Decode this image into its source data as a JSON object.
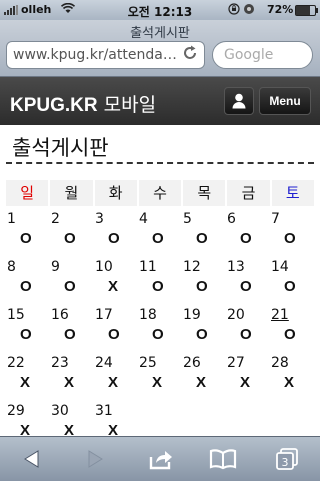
{
  "status_bar": {
    "carrier": "olleh",
    "time": "오전 12:13",
    "battery_percent": "72%",
    "battery_level": 0.72
  },
  "browser": {
    "page_title": "출석게시판",
    "url": "www.kpug.kr/attendan…",
    "search_placeholder": "Google",
    "tab_count": "3"
  },
  "site": {
    "logo_brand": "KPUG.KR",
    "logo_suffix": "모바일",
    "menu_label": "Menu"
  },
  "page": {
    "heading": "출석게시판"
  },
  "weekdays": [
    {
      "label": "일",
      "color": "#e00000"
    },
    {
      "label": "월",
      "color": "#111111"
    },
    {
      "label": "화",
      "color": "#111111"
    },
    {
      "label": "수",
      "color": "#111111"
    },
    {
      "label": "목",
      "color": "#111111"
    },
    {
      "label": "금",
      "color": "#111111"
    },
    {
      "label": "토",
      "color": "#2020d0"
    }
  ],
  "calendar": {
    "weeks": [
      [
        {
          "day": "1",
          "mark": "O"
        },
        {
          "day": "2",
          "mark": "O"
        },
        {
          "day": "3",
          "mark": "O"
        },
        {
          "day": "4",
          "mark": "O"
        },
        {
          "day": "5",
          "mark": "O"
        },
        {
          "day": "6",
          "mark": "O"
        },
        {
          "day": "7",
          "mark": "O"
        }
      ],
      [
        {
          "day": "8",
          "mark": "O"
        },
        {
          "day": "9",
          "mark": "O"
        },
        {
          "day": "10",
          "mark": "X"
        },
        {
          "day": "11",
          "mark": "O"
        },
        {
          "day": "12",
          "mark": "O"
        },
        {
          "day": "13",
          "mark": "O"
        },
        {
          "day": "14",
          "mark": "O"
        }
      ],
      [
        {
          "day": "15",
          "mark": "O"
        },
        {
          "day": "16",
          "mark": "O"
        },
        {
          "day": "17",
          "mark": "O"
        },
        {
          "day": "18",
          "mark": "O"
        },
        {
          "day": "19",
          "mark": "O"
        },
        {
          "day": "20",
          "mark": "O"
        },
        {
          "day": "21",
          "mark": "O",
          "underline": true
        }
      ],
      [
        {
          "day": "22",
          "mark": "X"
        },
        {
          "day": "23",
          "mark": "X"
        },
        {
          "day": "24",
          "mark": "X"
        },
        {
          "day": "25",
          "mark": "X"
        },
        {
          "day": "26",
          "mark": "X"
        },
        {
          "day": "27",
          "mark": "X"
        },
        {
          "day": "28",
          "mark": "X"
        }
      ],
      [
        {
          "day": "29",
          "mark": "X"
        },
        {
          "day": "30",
          "mark": "X"
        },
        {
          "day": "31",
          "mark": "X"
        }
      ]
    ]
  },
  "toolbar": {
    "buttons": [
      "back-icon",
      "forward-icon",
      "share-icon",
      "bookmarks-icon",
      "tabs-icon"
    ]
  }
}
